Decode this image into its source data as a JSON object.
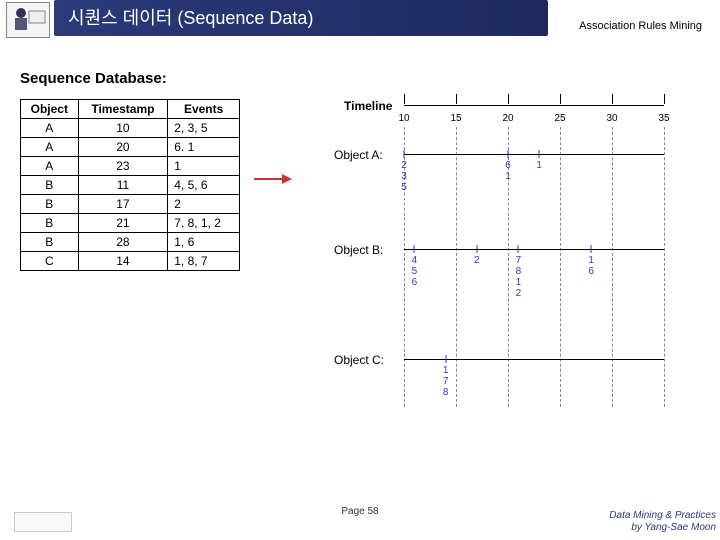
{
  "header": {
    "title": "시퀀스 데이터 (Sequence Data)",
    "subtitle": "Association Rules Mining"
  },
  "section_label": "Sequence Database:",
  "table": {
    "headers": [
      "Object",
      "Timestamp",
      "Events"
    ],
    "rows": [
      [
        "A",
        "10",
        "2, 3, 5"
      ],
      [
        "A",
        "20",
        "6. 1"
      ],
      [
        "A",
        "23",
        "1"
      ],
      [
        "B",
        "11",
        "4, 5, 6"
      ],
      [
        "B",
        "17",
        "2"
      ],
      [
        "B",
        "21",
        "7. 8, 1, 2"
      ],
      [
        "B",
        "28",
        "1, 6"
      ],
      [
        "C",
        "14",
        "1, 8, 7"
      ]
    ]
  },
  "timeline": {
    "label": "Timeline",
    "ticks": [
      "10",
      "15",
      "20",
      "25",
      "30",
      "35"
    ],
    "objects": [
      {
        "name": "Object A:",
        "events": [
          {
            "t": 10,
            "vals": [
              "2",
              "3",
              "5"
            ]
          },
          {
            "t": 20,
            "vals": [
              "6",
              "1"
            ]
          },
          {
            "t": 23,
            "vals": [
              "1"
            ]
          }
        ]
      },
      {
        "name": "Object B:",
        "events": [
          {
            "t": 11,
            "vals": [
              "4",
              "5",
              "6"
            ]
          },
          {
            "t": 17,
            "vals": [
              "2"
            ]
          },
          {
            "t": 21,
            "vals": [
              "7",
              "8",
              "1",
              "2"
            ]
          },
          {
            "t": 28,
            "vals": [
              "1",
              "6"
            ]
          }
        ]
      },
      {
        "name": "Object C:",
        "events": [
          {
            "t": 14,
            "vals": [
              "1",
              "7",
              "8"
            ]
          }
        ]
      }
    ]
  },
  "footer": {
    "page": "Page 58",
    "credit1": "Data Mining & Practices",
    "credit2": "by Yang-Sae Moon"
  },
  "chart_data": {
    "type": "table",
    "title": "Sequence Database",
    "columns": [
      "Object",
      "Timestamp",
      "Events"
    ],
    "rows": [
      [
        "A",
        10,
        "2,3,5"
      ],
      [
        "A",
        20,
        "6,1"
      ],
      [
        "A",
        23,
        "1"
      ],
      [
        "B",
        11,
        "4,5,6"
      ],
      [
        "B",
        17,
        "2"
      ],
      [
        "B",
        21,
        "7,8,1,2"
      ],
      [
        "B",
        28,
        "1,6"
      ],
      [
        "C",
        14,
        "1,8,7"
      ]
    ],
    "timeline_range": [
      10,
      35
    ]
  }
}
